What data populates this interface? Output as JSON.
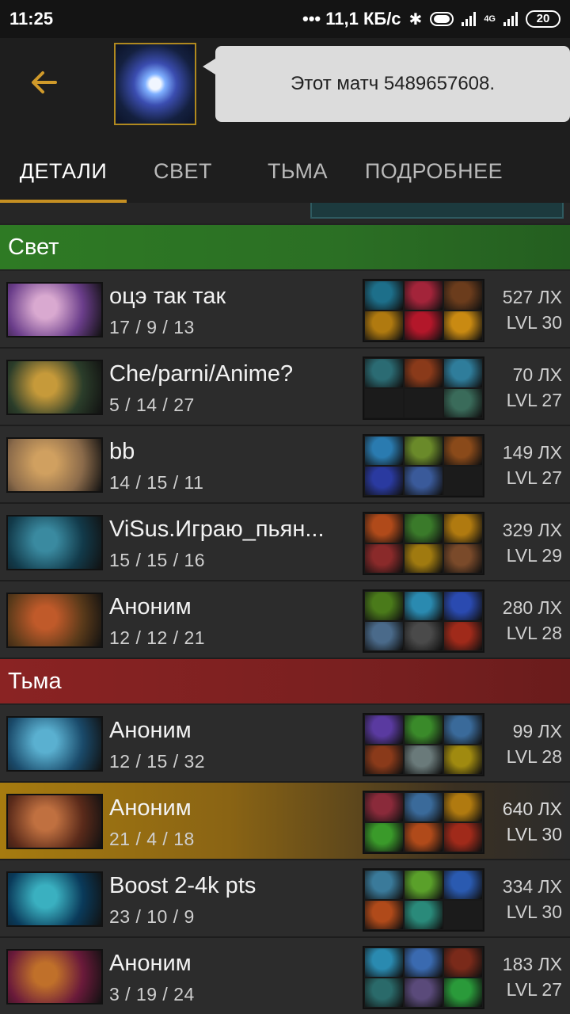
{
  "status_bar": {
    "time": "11:25",
    "speed": "11,1 КБ/с",
    "network": "4G",
    "battery": "20"
  },
  "header": {
    "back_icon": "arrow-left-icon",
    "match_message": "Этот матч 5489657608."
  },
  "tabs": [
    {
      "label": "ДЕТАЛИ",
      "active": true
    },
    {
      "label": "СВЕТ",
      "active": false
    },
    {
      "label": "ТЬМА",
      "active": false
    },
    {
      "label": "ПОДРОБНЕЕ",
      "active": false
    }
  ],
  "radiant": {
    "title": "Свет",
    "color": "#2e7a24",
    "players": [
      {
        "name": "оцэ так так",
        "kda": "17 / 9 / 13",
        "gpm": "527 ЛХ",
        "level": "LVL 30",
        "portrait_colors": [
          "#6a3d8a",
          "#d9a9d0"
        ],
        "items": [
          "#1d6f8a",
          "#a3243a",
          "#6b3c1c",
          "#b07a10",
          "#b3172a",
          "#c98a12"
        ]
      },
      {
        "name": "Che/parni/Anime?",
        "kda": "5 / 14 / 27",
        "gpm": "70 ЛХ",
        "level": "LVL 27",
        "portrait_colors": [
          "#2b3d2a",
          "#c69a3a"
        ],
        "items": [
          "#2b6b73",
          "#8a3a1a",
          "#2f7d9b",
          "#1b1b1b",
          "#1b1b1b",
          "#3a6b5a"
        ]
      },
      {
        "name": "bb",
        "kda": "14 / 15 / 11",
        "gpm": "149 ЛХ",
        "level": "LVL 27",
        "portrait_colors": [
          "#8a6a4a",
          "#d0a060"
        ],
        "items": [
          "#2a7bb0",
          "#6a8a2a",
          "#8a4a1a",
          "#2a3aa0",
          "#3a5a9a",
          "#1b1b1b"
        ]
      },
      {
        "name": "ViSus.Играю_пьян...",
        "kda": "15 / 15 / 16",
        "gpm": "329 ЛХ",
        "level": "LVL 29",
        "portrait_colors": [
          "#123a4a",
          "#3a8aa0"
        ],
        "items": [
          "#b04a1a",
          "#3a7a2a",
          "#b07a10",
          "#8a2a2a",
          "#a07a10",
          "#7a4a2a"
        ]
      },
      {
        "name": "Аноним",
        "kda": "12 / 12 / 21",
        "gpm": "280 ЛХ",
        "level": "LVL 28",
        "portrait_colors": [
          "#5a3a1a",
          "#c05a2a"
        ],
        "items": [
          "#4a7a1a",
          "#2a8ab0",
          "#2a4ab0",
          "#4a6a8a",
          "#4a4a4a",
          "#a02a1a"
        ]
      }
    ]
  },
  "dire": {
    "title": "Тьма",
    "color": "#8a2323",
    "players": [
      {
        "name": "Аноним",
        "kda": "12 / 15 / 32",
        "gpm": "99 ЛХ",
        "level": "LVL 28",
        "portrait_colors": [
          "#1a4a6a",
          "#5ab0d0"
        ],
        "items": [
          "#5a3aa0",
          "#3a8a2a",
          "#3a6a9a",
          "#8a3a1a",
          "#6a7a7a",
          "#a08a10"
        ]
      },
      {
        "name": "Аноним",
        "kda": "21 / 4 / 18",
        "gpm": "640 ЛХ",
        "level": "LVL 30",
        "portrait_colors": [
          "#5a2a1a",
          "#c07040"
        ],
        "items": [
          "#8a2a3a",
          "#3a6a9a",
          "#b07a10",
          "#3a9a2a",
          "#b04a1a",
          "#a02a1a"
        ],
        "highlight": true
      },
      {
        "name": "Boost 2-4k pts",
        "kda": "23 / 10 / 9",
        "gpm": "334 ЛХ",
        "level": "LVL 30",
        "portrait_colors": [
          "#0a3a5a",
          "#3ab0c0"
        ],
        "items": [
          "#3a7a9a",
          "#5aa02a",
          "#2a5ab0",
          "#b04a1a",
          "#2a8a7a",
          "#1b1b1b"
        ]
      },
      {
        "name": "Аноним",
        "kda": "3 / 19 / 24",
        "gpm": "183 ЛХ",
        "level": "LVL 27",
        "portrait_colors": [
          "#6a1a3a",
          "#c0702a"
        ],
        "items": [
          "#2a8ab0",
          "#3a6ab0",
          "#7a2a1a",
          "#2a6a6a",
          "#5a4a7a",
          "#2a9a3a"
        ]
      }
    ]
  }
}
